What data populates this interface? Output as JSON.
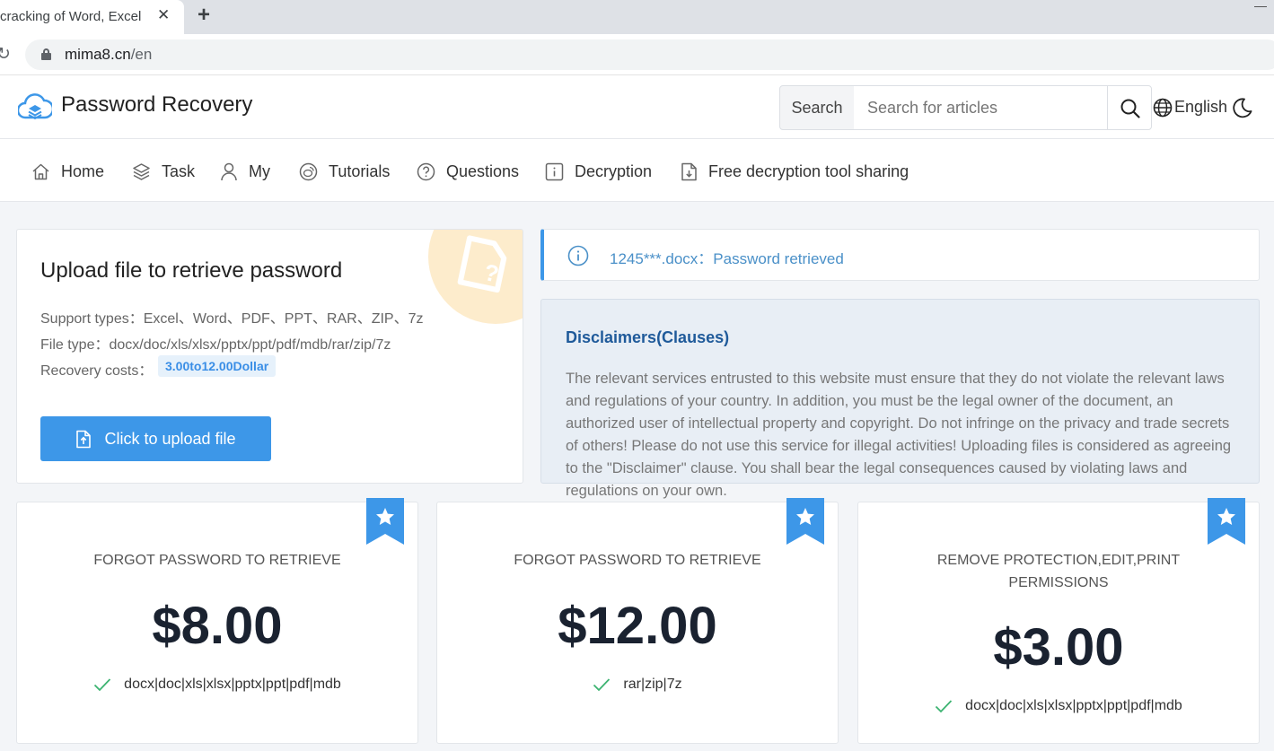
{
  "browser": {
    "tab_title": "cracking of Word, Excel",
    "close_glyph": "✕",
    "new_tab_glyph": "+",
    "reload_glyph": "↻",
    "url_host": "mima8.cn",
    "url_path": "/en"
  },
  "header": {
    "site_title": "Password Recovery",
    "search_label": "Search",
    "search_placeholder": "Search for articles",
    "language": "English"
  },
  "nav": {
    "items": [
      {
        "label": "Home",
        "icon": "home-icon"
      },
      {
        "label": "Task",
        "icon": "layers-icon"
      },
      {
        "label": "My",
        "icon": "user-icon"
      },
      {
        "label": "Tutorials",
        "icon": "weibo-icon"
      },
      {
        "label": "Questions",
        "icon": "question-icon"
      },
      {
        "label": "Decryption",
        "icon": "info-icon"
      },
      {
        "label": "Free decryption tool sharing",
        "icon": "download-file-icon"
      }
    ]
  },
  "upload": {
    "title": "Upload file to retrieve password",
    "support_types": "Support types：Excel、Word、PDF、PPT、RAR、ZIP、7z",
    "file_type": "File type：docx/doc/xls/xlsx/pptx/ppt/pdf/mdb/rar/zip/7z",
    "cost_label": "Recovery costs：",
    "cost_value": "3.00to12.00Dollar",
    "button_label": "Click to upload file"
  },
  "notice": {
    "text": "1245***.docx：Password retrieved"
  },
  "disclaimer": {
    "title": "Disclaimers(Clauses)",
    "body": "The relevant services entrusted to this website must ensure that they do not violate the relevant laws and regulations of your country. In addition, you must be the legal owner of the document, an authorized user of intellectual property and copyright. Do not infringe on the privacy and trade secrets of others! Please do not use this service for illegal activities! Uploading files is considered as agreeing to the \"Disclaimer\" clause. You shall bear the legal consequences caused by violating laws and regulations on your own."
  },
  "pricing": [
    {
      "name": "FORGOT PASSWORD TO RETRIEVE",
      "price": "$8.00",
      "formats": "docx|doc|xls|xlsx|pptx|ppt|pdf|mdb"
    },
    {
      "name": "FORGOT PASSWORD TO RETRIEVE",
      "price": "$12.00",
      "formats": "rar|zip|7z"
    },
    {
      "name": "REMOVE PROTECTION,EDIT,PRINT PERMISSIONS",
      "price": "$3.00",
      "formats": "docx|doc|xls|xlsx|pptx|ppt|pdf|mdb"
    }
  ],
  "colors": {
    "accent": "#3d97e8",
    "badge_bg": "#e6f1fb",
    "disclaimer_bg": "#e8eef5",
    "check": "#3cb371"
  }
}
